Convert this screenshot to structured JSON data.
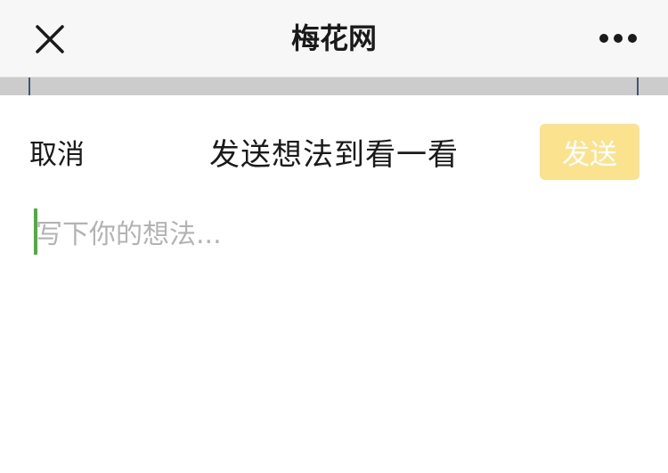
{
  "nav": {
    "title": "梅花网",
    "close_icon": "close-icon",
    "more_icon": "more-dots-icon"
  },
  "compose": {
    "cancel_label": "取消",
    "title": "发送想法到看一看",
    "send_label": "发送",
    "input_value": "",
    "input_placeholder": "写下你的想法..."
  },
  "colors": {
    "send_button_bg": "#fae28f",
    "caret": "#4caf3a",
    "strip": "#cccccc"
  }
}
